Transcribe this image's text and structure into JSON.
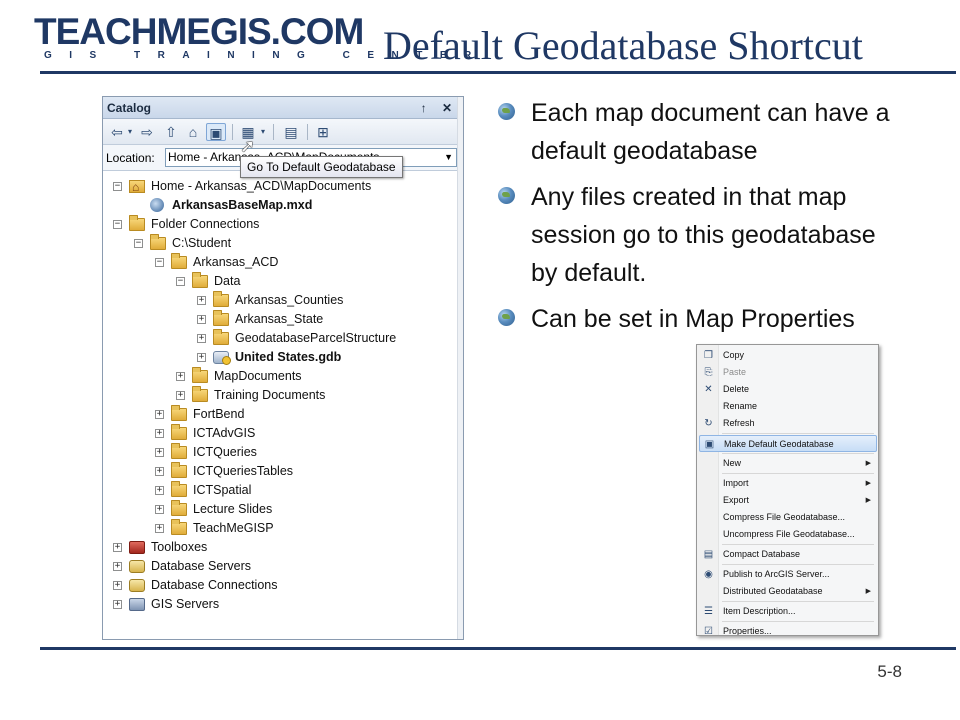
{
  "logo": {
    "main": "TEACHMEGIS.COM",
    "sub": "GIS TRAINING CENTER"
  },
  "slide": {
    "title": "Default Geodatabase Shortcut",
    "page_number": "5-8"
  },
  "bullets": [
    "Each map document can have a default geodatabase",
    "Any files created in that map session go to this geodatabase by default.",
    "Can be set in Map Properties"
  ],
  "catalog": {
    "title": "Catalog",
    "title_buttons": "↑ ✕",
    "location_label": "Location:",
    "location_value": "Home - Arkansas_ACD\\MapDocuments",
    "tooltip": "Go To Default Geodatabase",
    "toolbar_icons": [
      "back-icon",
      "forward-icon",
      "up-folder-icon",
      "home-icon",
      "default-geodatabase-icon",
      "view-options-icon",
      "new-folder-icon",
      "tree-options-icon"
    ],
    "tree": [
      {
        "label": "Home - Arkansas_ACD\\MapDocuments",
        "level": 0,
        "toggle": "−",
        "icon": "home",
        "bold": false
      },
      {
        "label": "ArkansasBaseMap.mxd",
        "level": 1,
        "toggle": "",
        "icon": "mxd",
        "bold": true
      },
      {
        "label": "Folder Connections",
        "level": 0,
        "toggle": "−",
        "icon": "folder",
        "bold": false
      },
      {
        "label": "C:\\Student",
        "level": 1,
        "toggle": "−",
        "icon": "folder",
        "bold": false
      },
      {
        "label": "Arkansas_ACD",
        "level": 2,
        "toggle": "−",
        "icon": "folder",
        "bold": false
      },
      {
        "label": "Data",
        "level": 3,
        "toggle": "−",
        "icon": "folder",
        "bold": false
      },
      {
        "label": "Arkansas_Counties",
        "level": 4,
        "toggle": "+",
        "icon": "folder",
        "bold": false
      },
      {
        "label": "Arkansas_State",
        "level": 4,
        "toggle": "+",
        "icon": "folder",
        "bold": false
      },
      {
        "label": "GeodatabaseParcelStructure",
        "level": 4,
        "toggle": "+",
        "icon": "folder",
        "bold": false
      },
      {
        "label": "United States.gdb",
        "level": 4,
        "toggle": "+",
        "icon": "gdb",
        "bold": true
      },
      {
        "label": "MapDocuments",
        "level": 3,
        "toggle": "+",
        "icon": "folder",
        "bold": false
      },
      {
        "label": "Training Documents",
        "level": 3,
        "toggle": "+",
        "icon": "folder",
        "bold": false
      },
      {
        "label": "FortBend",
        "level": 2,
        "toggle": "+",
        "icon": "folder",
        "bold": false
      },
      {
        "label": "ICTAdvGIS",
        "level": 2,
        "toggle": "+",
        "icon": "folder",
        "bold": false
      },
      {
        "label": "ICTQueries",
        "level": 2,
        "toggle": "+",
        "icon": "folder",
        "bold": false
      },
      {
        "label": "ICTQueriesTables",
        "level": 2,
        "toggle": "+",
        "icon": "folder",
        "bold": false
      },
      {
        "label": "ICTSpatial",
        "level": 2,
        "toggle": "+",
        "icon": "folder",
        "bold": false
      },
      {
        "label": "Lecture Slides",
        "level": 2,
        "toggle": "+",
        "icon": "folder",
        "bold": false
      },
      {
        "label": "TeachMeGISP",
        "level": 2,
        "toggle": "+",
        "icon": "folder",
        "bold": false
      },
      {
        "label": "Toolboxes",
        "level": 0,
        "toggle": "+",
        "icon": "toolbox",
        "bold": false
      },
      {
        "label": "Database Servers",
        "level": 0,
        "toggle": "+",
        "icon": "db",
        "bold": false
      },
      {
        "label": "Database Connections",
        "level": 0,
        "toggle": "+",
        "icon": "db",
        "bold": false
      },
      {
        "label": "GIS Servers",
        "level": 0,
        "toggle": "+",
        "icon": "gis",
        "bold": false
      }
    ]
  },
  "context_menu": {
    "items": [
      {
        "label": "Copy",
        "icon": "copy-icon",
        "glyph": "❐",
        "submenu": false,
        "disabled": false,
        "highlight": false
      },
      {
        "label": "Paste",
        "icon": "paste-icon",
        "glyph": "⎘",
        "submenu": false,
        "disabled": true,
        "highlight": false
      },
      {
        "label": "Delete",
        "icon": "delete-icon",
        "glyph": "✕",
        "submenu": false,
        "disabled": false,
        "highlight": false
      },
      {
        "label": "Rename",
        "icon": "",
        "glyph": "",
        "submenu": false,
        "disabled": false,
        "highlight": false
      },
      {
        "label": "Refresh",
        "icon": "refresh-icon",
        "glyph": "↻",
        "submenu": false,
        "disabled": false,
        "highlight": false,
        "sep_after": true
      },
      {
        "label": "Make Default Geodatabase",
        "icon": "default-geodatabase-icon",
        "glyph": "▣",
        "submenu": false,
        "disabled": false,
        "highlight": true,
        "sep_after": true
      },
      {
        "label": "New",
        "icon": "",
        "glyph": "",
        "submenu": true,
        "disabled": false,
        "highlight": false,
        "sep_after": true
      },
      {
        "label": "Import",
        "icon": "",
        "glyph": "",
        "submenu": true,
        "disabled": false,
        "highlight": false
      },
      {
        "label": "Export",
        "icon": "",
        "glyph": "",
        "submenu": true,
        "disabled": false,
        "highlight": false
      },
      {
        "label": "Compress File Geodatabase...",
        "icon": "",
        "glyph": "",
        "submenu": false,
        "disabled": false,
        "highlight": false
      },
      {
        "label": "Uncompress File Geodatabase...",
        "icon": "",
        "glyph": "",
        "submenu": false,
        "disabled": false,
        "highlight": false,
        "sep_after": true
      },
      {
        "label": "Compact Database",
        "icon": "compact-database-icon",
        "glyph": "▤",
        "submenu": false,
        "disabled": false,
        "highlight": false,
        "sep_after": true
      },
      {
        "label": "Publish to ArcGIS Server...",
        "icon": "publish-icon",
        "glyph": "◉",
        "submenu": false,
        "disabled": false,
        "highlight": false
      },
      {
        "label": "Distributed Geodatabase",
        "icon": "",
        "glyph": "",
        "submenu": true,
        "disabled": false,
        "highlight": false,
        "sep_after": true
      },
      {
        "label": "Item Description...",
        "icon": "item-description-icon",
        "glyph": "☰",
        "submenu": false,
        "disabled": false,
        "highlight": false,
        "sep_after": true
      },
      {
        "label": "Properties...",
        "icon": "properties-icon",
        "glyph": "☑",
        "submenu": false,
        "disabled": false,
        "highlight": false
      }
    ]
  },
  "colors": {
    "accent": "#1f3864",
    "highlight": "#c7ddf6"
  }
}
